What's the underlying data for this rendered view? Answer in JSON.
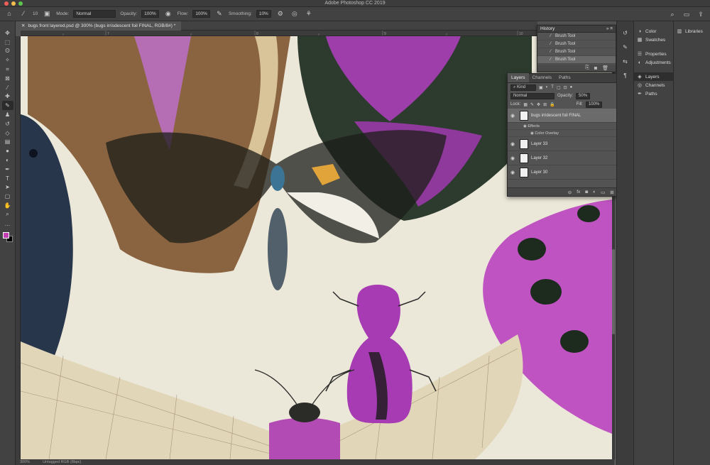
{
  "window": {
    "title": "Adobe Photoshop CC 2019",
    "traffic_colors": [
      "#ee5d58",
      "#f4bd4f",
      "#5ec44e"
    ]
  },
  "options_bar": {
    "brush_size": "10",
    "mode_label": "Mode:",
    "mode_value": "Normal",
    "opacity_label": "Opacity:",
    "opacity_value": "100%",
    "flow_label": "Flow:",
    "flow_value": "100%",
    "smoothing_label": "Smoothing:",
    "smoothing_value": "10%"
  },
  "document": {
    "tab_title": "bugs front layered.psd @ 300% (bugs irrisdescent foil FINAL, RGB/8#) *",
    "ruler_marks": [
      "7",
      "8",
      "9",
      "10",
      "11",
      "12"
    ],
    "status_zoom": "300%",
    "status_info": "Untagged RGB (8bpc)"
  },
  "tools": {
    "icons": [
      "move-icon",
      "marquee-icon",
      "lasso-icon",
      "quick-select-icon",
      "crop-icon",
      "frame-icon",
      "eyedropper-icon",
      "spot-heal-icon",
      "brush-icon",
      "clone-stamp-icon",
      "history-brush-icon",
      "eraser-icon",
      "gradient-icon",
      "blur-icon",
      "dodge-icon",
      "pen-icon",
      "type-icon",
      "path-select-icon",
      "rectangle-icon",
      "hand-icon",
      "zoom-icon",
      "more-tools-icon"
    ],
    "active_index": 8,
    "foreground_color": "#c23fb3",
    "background_color": "#000000"
  },
  "history": {
    "title": "History",
    "items": [
      "Brush Tool",
      "Brush Tool",
      "Brush Tool",
      "Brush Tool"
    ],
    "selected_index": 3
  },
  "layers": {
    "tabs": [
      "Layers",
      "Channels",
      "Paths"
    ],
    "active_tab": 0,
    "filter_kind": "Kind",
    "blend_mode": "Normal",
    "opacity_label": "Opacity:",
    "opacity_value": "50%",
    "lock_label": "Lock:",
    "fill_label": "Fill:",
    "fill_value": "100%",
    "items": [
      {
        "name": "bugs irridescent foil FINAL",
        "has_fx": true,
        "selected": true
      },
      {
        "name": "Layer 33"
      },
      {
        "name": "Layer 32"
      },
      {
        "name": "Layer 30"
      }
    ],
    "effects_label": "Effects",
    "effect_name": "Color Overlay",
    "fx_badge": "fx"
  },
  "side_panels": {
    "group1": [
      "Color",
      "Swatches"
    ],
    "group2": [
      "Properties",
      "Adjustments"
    ],
    "group3": [
      "Layers",
      "Channels",
      "Paths"
    ],
    "active": "Layers",
    "libraries": "Libraries"
  },
  "artwork_colors": {
    "paper": "#ebe7d9",
    "magenta": "#b23ab6",
    "brown": "#8a6440",
    "dark": "#2b2e2a",
    "navy": "#27364a"
  }
}
